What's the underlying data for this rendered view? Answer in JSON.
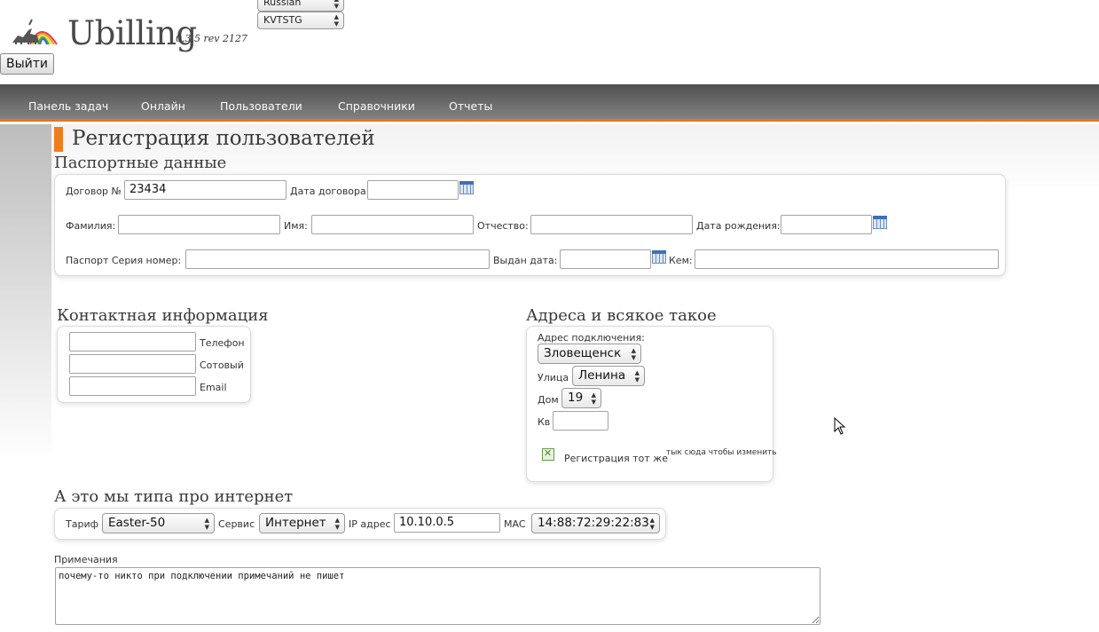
{
  "header": {
    "app_name": "Ubilling",
    "version": "0.3.5 rev 2127",
    "language_select": "Russian",
    "user_select": "KVTSTG",
    "logout_label": "Выйти"
  },
  "nav": {
    "items": [
      {
        "label": "Панель задач"
      },
      {
        "label": "Онлайн"
      },
      {
        "label": "Пользователи"
      },
      {
        "label": "Справочники"
      },
      {
        "label": "Отчеты"
      }
    ]
  },
  "page": {
    "title": "Регистрация пользователей"
  },
  "passport": {
    "section_title": "Паспортные данные",
    "contract_label": "Договор №",
    "contract_value": "23434",
    "contract_date_label": "Дата договора",
    "contract_date_value": "",
    "surname_label": "Фамилия:",
    "name_label": "Имя:",
    "patronymic_label": "Отчество:",
    "birthdate_label": "Дата рождения:",
    "passport_label": "Паспорт Серия номер:",
    "issued_date_label": "Выдан дата:",
    "issued_by_label": "Кем:"
  },
  "contacts": {
    "section_title": "Контактная информация",
    "phone_label": "Телефон",
    "mobile_label": "Сотовый",
    "email_label": "Email"
  },
  "address": {
    "section_title": "Адреса и всякое такое",
    "connect_label": "Адрес подключения:",
    "city_value": "Зловещенск",
    "street_label": "Улица",
    "street_value": "Ленина",
    "house_label": "Дом",
    "house_value": "19",
    "apt_label": "Кв",
    "apt_value": "",
    "same_reg_label": "Регистрация тот же",
    "change_hint": "тык сюда чтобы изменить"
  },
  "internet": {
    "section_title": "А это мы типа про интернет",
    "tariff_label": "Тариф",
    "tariff_value": "Easter-50",
    "service_label": "Сервис",
    "service_value": "Интернет",
    "ip_label": "IP адрес",
    "ip_value": "10.10.0.5",
    "mac_label": "MAC",
    "mac_value": "14:88:72:29:22:83"
  },
  "notes": {
    "label": "Примечания",
    "value": "почему-то никто при подключении примечаний не пишет"
  },
  "colors": {
    "accent": "#f07d1c",
    "nav_bg": "#5f5f5f"
  }
}
